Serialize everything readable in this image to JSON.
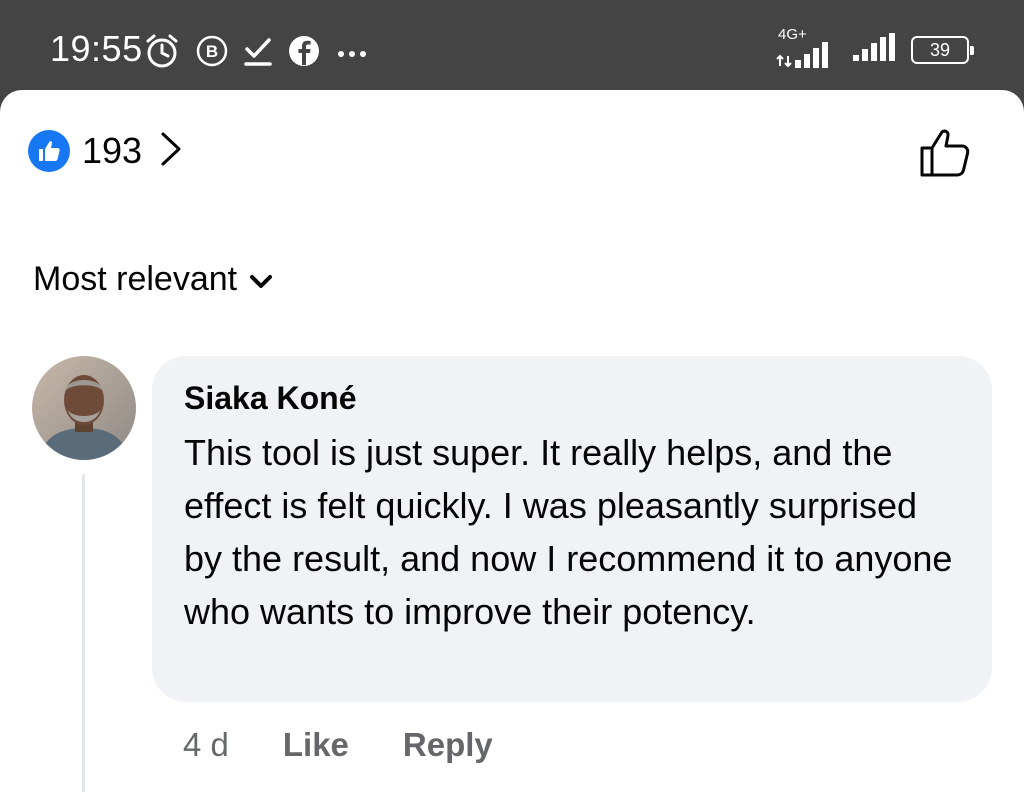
{
  "status_bar": {
    "time": "19:55",
    "network_label": "4G+",
    "battery": "39",
    "icons": [
      "alarm-icon",
      "b-badge-icon",
      "download-check-icon",
      "facebook-icon",
      "more-dots-icon",
      "signal-icon",
      "battery-icon"
    ]
  },
  "reactions": {
    "count": "193",
    "reaction_icon": "like-icon",
    "accent_color": "#1877f2"
  },
  "sort": {
    "label": "Most relevant"
  },
  "comment": {
    "author": "Siaka Koné",
    "text": "This tool is just super. It really helps, and the effect is felt quickly. I was pleasantly surprised by the result, and now I recommend it to anyone who wants to improve their potency.",
    "time": "4 d",
    "like_label": "Like",
    "reply_label": "Reply",
    "bubble_color": "#f0f2f5"
  }
}
